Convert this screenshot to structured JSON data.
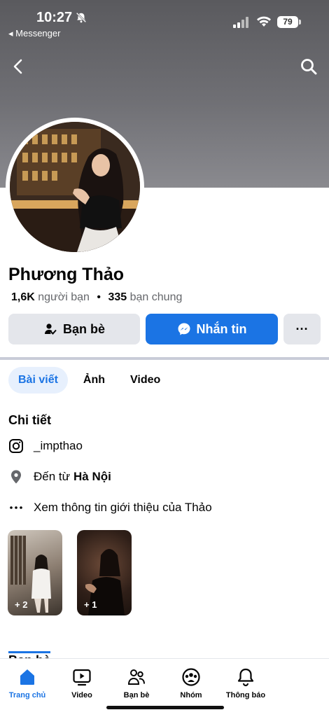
{
  "status_bar": {
    "time": "10:27",
    "back_app": "◂ Messenger",
    "battery": "79"
  },
  "profile": {
    "name": "Phương Thảo",
    "friends_count": "1,6K",
    "friends_label": "người bạn",
    "separator": "•",
    "mutual_count": "335",
    "mutual_label": "bạn chung"
  },
  "actions": {
    "friends_label": "Bạn bè",
    "message_label": "Nhắn tin",
    "more_label": "···"
  },
  "tabs": [
    {
      "label": "Bài viết",
      "active": true
    },
    {
      "label": "Ảnh",
      "active": false
    },
    {
      "label": "Video",
      "active": false
    }
  ],
  "details": {
    "title": "Chi tiết",
    "instagram": "_impthao",
    "from_prefix": "Đến từ",
    "from_place": "Hà Nội",
    "more_info": "Xem thông tin giới thiệu của Thảo"
  },
  "photos": [
    {
      "count": "+ 2"
    },
    {
      "count": "+ 1"
    }
  ],
  "friends_section": {
    "title": "Bạn bè"
  },
  "bottom_nav": [
    {
      "label": "Trang chủ",
      "icon": "home-icon",
      "active": true
    },
    {
      "label": "Video",
      "icon": "video-icon",
      "active": false
    },
    {
      "label": "Bạn bè",
      "icon": "friends-icon",
      "active": false
    },
    {
      "label": "Nhóm",
      "icon": "groups-icon",
      "active": false
    },
    {
      "label": "Thông báo",
      "icon": "bell-icon",
      "active": false
    }
  ],
  "colors": {
    "accent": "#1b74e4",
    "secondary_button": "#e4e6eb",
    "cover": "#6e6e73"
  }
}
